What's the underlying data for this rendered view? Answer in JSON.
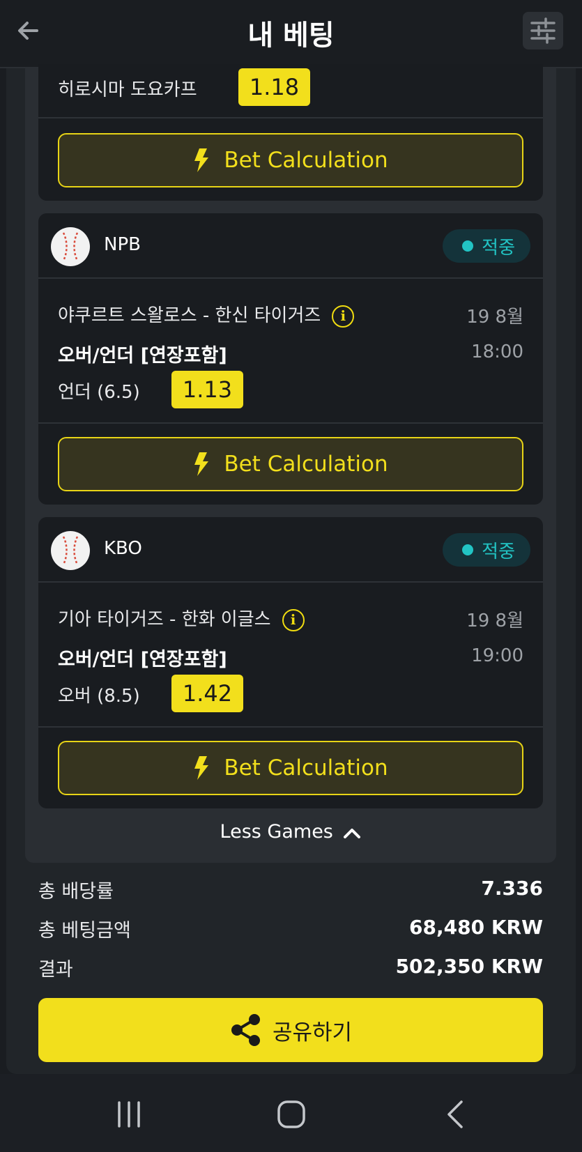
{
  "header": {
    "title": "내 베팅"
  },
  "partial_card": {
    "pick": "히로시마 도요카프",
    "odds": "1.18",
    "calc_label": "Bet Calculation"
  },
  "cards": [
    {
      "league": "NPB",
      "status": "적중",
      "match": "야쿠르트 스왈로스 - 한신 타이거즈",
      "date": "19 8월",
      "market": "오버/언더 [연장포함]",
      "time": "18:00",
      "pick": "언더 (6.5)",
      "odds": "1.13",
      "calc_label": "Bet Calculation"
    },
    {
      "league": "KBO",
      "status": "적중",
      "match": "기아 타이거즈 - 한화 이글스",
      "date": "19 8월",
      "market": "오버/언더 [연장포함]",
      "time": "19:00",
      "pick": "오버 (8.5)",
      "odds": "1.42",
      "calc_label": "Bet Calculation"
    }
  ],
  "less_games": "Less Games",
  "summary": [
    {
      "label": "총 배당률",
      "value": "7.336"
    },
    {
      "label": "총 베팅금액",
      "value": "68,480 KRW"
    },
    {
      "label": "결과",
      "value": "502,350 KRW"
    }
  ],
  "share_label": "공유하기",
  "colors": {
    "accent": "#f2df1c",
    "win": "#22c4c4",
    "background": "#1a1d21"
  },
  "icons": [
    "back-arrow-icon",
    "filter-sliders-icon",
    "baseball-icon",
    "lightning-icon",
    "info-icon",
    "chevron-up-icon",
    "share-icon",
    "recents-icon",
    "home-icon",
    "back-icon"
  ]
}
